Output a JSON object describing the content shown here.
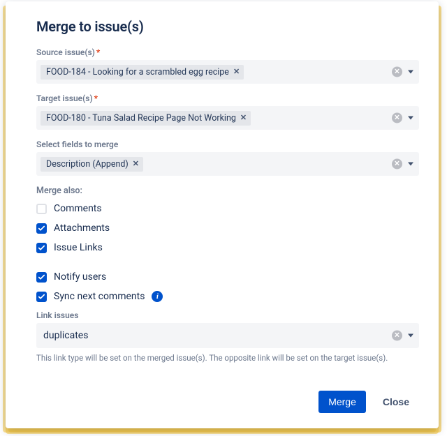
{
  "title": "Merge to issue(s)",
  "labels": {
    "source": "Source issue(s)",
    "target": "Target issue(s)",
    "fields": "Select fields to merge",
    "mergeAlso": "Merge also:",
    "linkIssues": "Link issues"
  },
  "required": "*",
  "source": {
    "chips": [
      "FOOD-184 - Looking for a scrambled egg recipe"
    ]
  },
  "target": {
    "chips": [
      "FOOD-180 - Tuna Salad Recipe Page Not Working"
    ]
  },
  "fields": {
    "chips": [
      "Description (Append)"
    ]
  },
  "mergeAlso": [
    {
      "key": "comments",
      "label": "Comments",
      "checked": false
    },
    {
      "key": "attachments",
      "label": "Attachments",
      "checked": true
    },
    {
      "key": "issueLinks",
      "label": "Issue Links",
      "checked": true
    }
  ],
  "options": [
    {
      "key": "notifyUsers",
      "label": "Notify users",
      "checked": true,
      "info": false
    },
    {
      "key": "syncNext",
      "label": "Sync next comments",
      "checked": true,
      "info": true
    }
  ],
  "linkIssues": {
    "value": "duplicates"
  },
  "helpText": "This link type will be set on the merged issue(s). The opposite link will be set on the target issue(s).",
  "buttons": {
    "merge": "Merge",
    "close": "Close"
  },
  "glyphs": {
    "chipX": "✕",
    "clearX": "✕",
    "info": "i"
  }
}
